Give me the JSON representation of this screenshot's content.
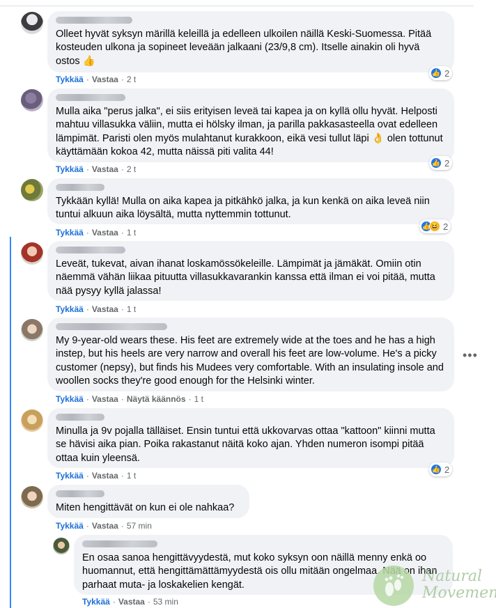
{
  "actions": {
    "like": "Tykkää",
    "reply": "Vastaa",
    "translate": "Näytä käännös"
  },
  "more_label": "•••",
  "comments": [
    {
      "text": "Olleet hyvät syksyn märillä keleillä ja edelleen ulkoilen näillä Keski-Suomessa. Pitää kosteuden ulkona ja sopineet leveään jalkaani (23/9,8 cm). Itselle ainakin oli hyvä ostos 👍",
      "time": "2 t",
      "reactions": "2"
    },
    {
      "text": "Mulla aika \"perus jalka\", ei siis erityisen leveä tai kapea ja on kyllä ollu hyvät. Helposti mahtuu villasukka väliin, mutta ei hölsky ilman, ja parilla pakkasasteella ovat edelleen lämpimät. Paristi olen myös mulahtanut kurakkoon, eikä vesi tullut läpi 👌 olen tottunut käyttämään kokoa 42, mutta näissä piti valita 44!",
      "time": "2 t",
      "reactions": "2"
    },
    {
      "text": "Tykkään kyllä! Mulla on aika kapea ja pitkähkö jalka, ja kun kenkä on aika leveä niin tuntui alkuun aika löysältä, mutta nyttemmin tottunut.",
      "time": "1 t",
      "reactions": "2"
    },
    {
      "text": "Leveät, tukevat, aivan ihanat loskamössökeleille. Lämpimät ja jämäkät. Omiin otin näemmä vähän liikaa pituutta villasukkavarankin kanssa että ilman ei voi pitää, mutta nää pysyy kyllä jalassa!",
      "time": "1 t"
    },
    {
      "text": "My 9-year-old wears these. His feet are extremely wide at the toes and he has a high instep, but his heels are very narrow and overall his feet are low-volume. He's a picky customer (nepsy), but finds his Mudees very comfortable. With an insulating insole and woollen socks they're good enough for the Helsinki winter.",
      "time": "1 t"
    },
    {
      "text": "Minulla ja 9v pojalla tälläiset. Ensin tuntui että ukkovarvas ottaa \"kattoon\" kiinni mutta se hävisi aika pian. Poika rakastanut näitä koko ajan. Yhden numeron isompi pitää ottaa kuin yleensä.",
      "time": "1 t",
      "reactions": "2"
    },
    {
      "text": "Miten hengittävät on kun ei ole nahkaa?",
      "time": "57 min"
    },
    {
      "text": "En osaa sanoa hengittävyydestä, mut koko syksyn oon näillä menny enkä oo huomannut, että hengittämättämyydestä ois ollu mitään ongelmaa. Nää on ihan parhaat muta- ja loskakelien kengät.",
      "time": "53 min"
    }
  ],
  "watermark": {
    "line1": "Natural",
    "line2": "Movement"
  },
  "colors": {
    "like_blue": "#1877f2",
    "thread_line": "#2e89ff",
    "bubble_bg": "#f0f2f5"
  }
}
